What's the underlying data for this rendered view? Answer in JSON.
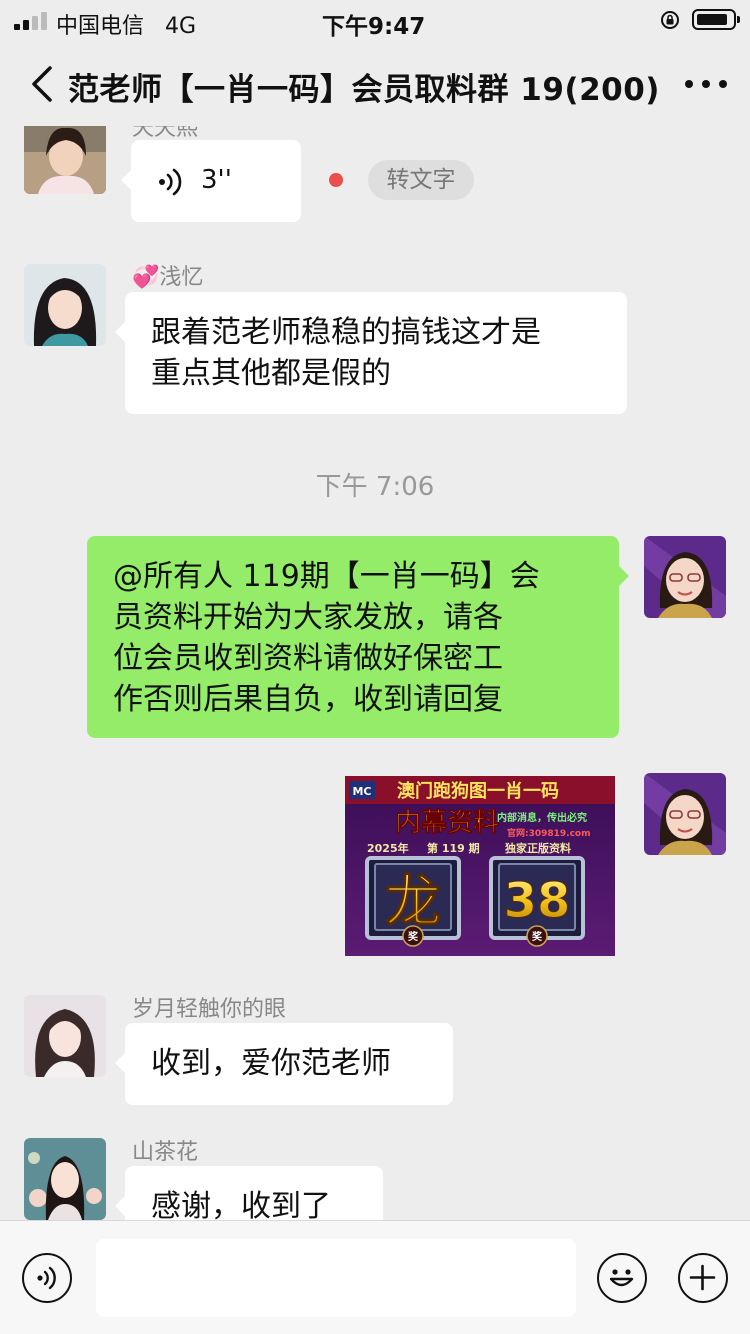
{
  "status_bar": {
    "carrier": "中国电信",
    "network": "4G",
    "time": "下午9:47",
    "signal_bars": 2,
    "battery_percent": 85
  },
  "nav": {
    "back_icon": "chevron-left-icon",
    "title": "范老师【一肖一码】会员取料群 19(200)",
    "more_icon": "more-dots-icon"
  },
  "messages": {
    "m1": {
      "sender": "天天熙",
      "voice_duration": "3''",
      "convert_label": "转文字",
      "unread_dot_color": "#ea4f4c"
    },
    "m2": {
      "sender_emoji": "💞",
      "sender": "浅忆",
      "line1": "跟着范老师稳稳的搞钱这才是",
      "line2": "重点其他都是假的"
    },
    "timestamp": "下午 7:06",
    "m3": {
      "line1": "@所有人 119期【一肖一码】会",
      "line2": "员资料开始为大家发放，请各",
      "line3": "位会员收到资料请做好保密工",
      "line4": "作否则后果自负，收到请回复",
      "bubble_color": "#95ec69"
    },
    "m4": {
      "logo_text": "MC",
      "title": "澳门跑狗图一肖一码",
      "subtitle": "内幕资料",
      "slogan": "内部消息，传出必究",
      "site": "官网:309819.com",
      "year": "2025年",
      "issue": "第 119 期",
      "tag": "独家正版资料",
      "zodiac": "龙",
      "number": "38",
      "medal_label": "奖"
    },
    "m5": {
      "sender": "岁月轻触你的眼",
      "text": "收到，爱你范老师"
    },
    "m6": {
      "sender": "山茶花",
      "text": "感谢，收到了"
    }
  },
  "input_bar": {
    "voice_icon": "voice-mode-icon",
    "input_value": "",
    "emoji_icon": "emoji-icon",
    "plus_icon": "plus-icon"
  }
}
